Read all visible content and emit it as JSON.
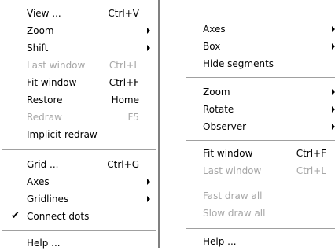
{
  "left_menu": {
    "items": [
      {
        "label": "View ...",
        "shortcut": "Ctrl+V"
      },
      {
        "label": "Zoom",
        "submenu": true
      },
      {
        "label": "Shift",
        "submenu": true
      },
      {
        "label": "Last window",
        "shortcut": "Ctrl+L",
        "disabled": true
      },
      {
        "label": "Fit window",
        "shortcut": "Ctrl+F"
      },
      {
        "label": "Restore",
        "shortcut": "Home"
      },
      {
        "label": "Redraw",
        "shortcut": "F5",
        "disabled": true
      },
      {
        "label": "Implicit redraw"
      },
      {
        "label": "Grid ...",
        "shortcut": "Ctrl+G"
      },
      {
        "label": "Axes",
        "submenu": true
      },
      {
        "label": "Gridlines",
        "submenu": true
      },
      {
        "label": "Connect dots",
        "checked": true,
        "check_symbol": "✔"
      },
      {
        "label": "Help ..."
      }
    ]
  },
  "right_menu": {
    "items": [
      {
        "label": "Axes",
        "submenu": true
      },
      {
        "label": "Box",
        "submenu": true
      },
      {
        "label": "Hide segments"
      },
      {
        "label": "Zoom",
        "submenu": true
      },
      {
        "label": "Rotate",
        "submenu": true
      },
      {
        "label": "Observer",
        "submenu": true
      },
      {
        "label": "Fit window",
        "shortcut": "Ctrl+F"
      },
      {
        "label": "Last window",
        "shortcut": "Ctrl+L",
        "disabled": true
      },
      {
        "label": "Fast draw all",
        "disabled": true
      },
      {
        "label": "Slow draw all",
        "disabled": true
      },
      {
        "label": "Help ..."
      }
    ]
  },
  "colors": {
    "background": "#ffffff",
    "text": "#000000",
    "disabled_text": "#a7a7a7",
    "separator": "#a0a0a0"
  }
}
